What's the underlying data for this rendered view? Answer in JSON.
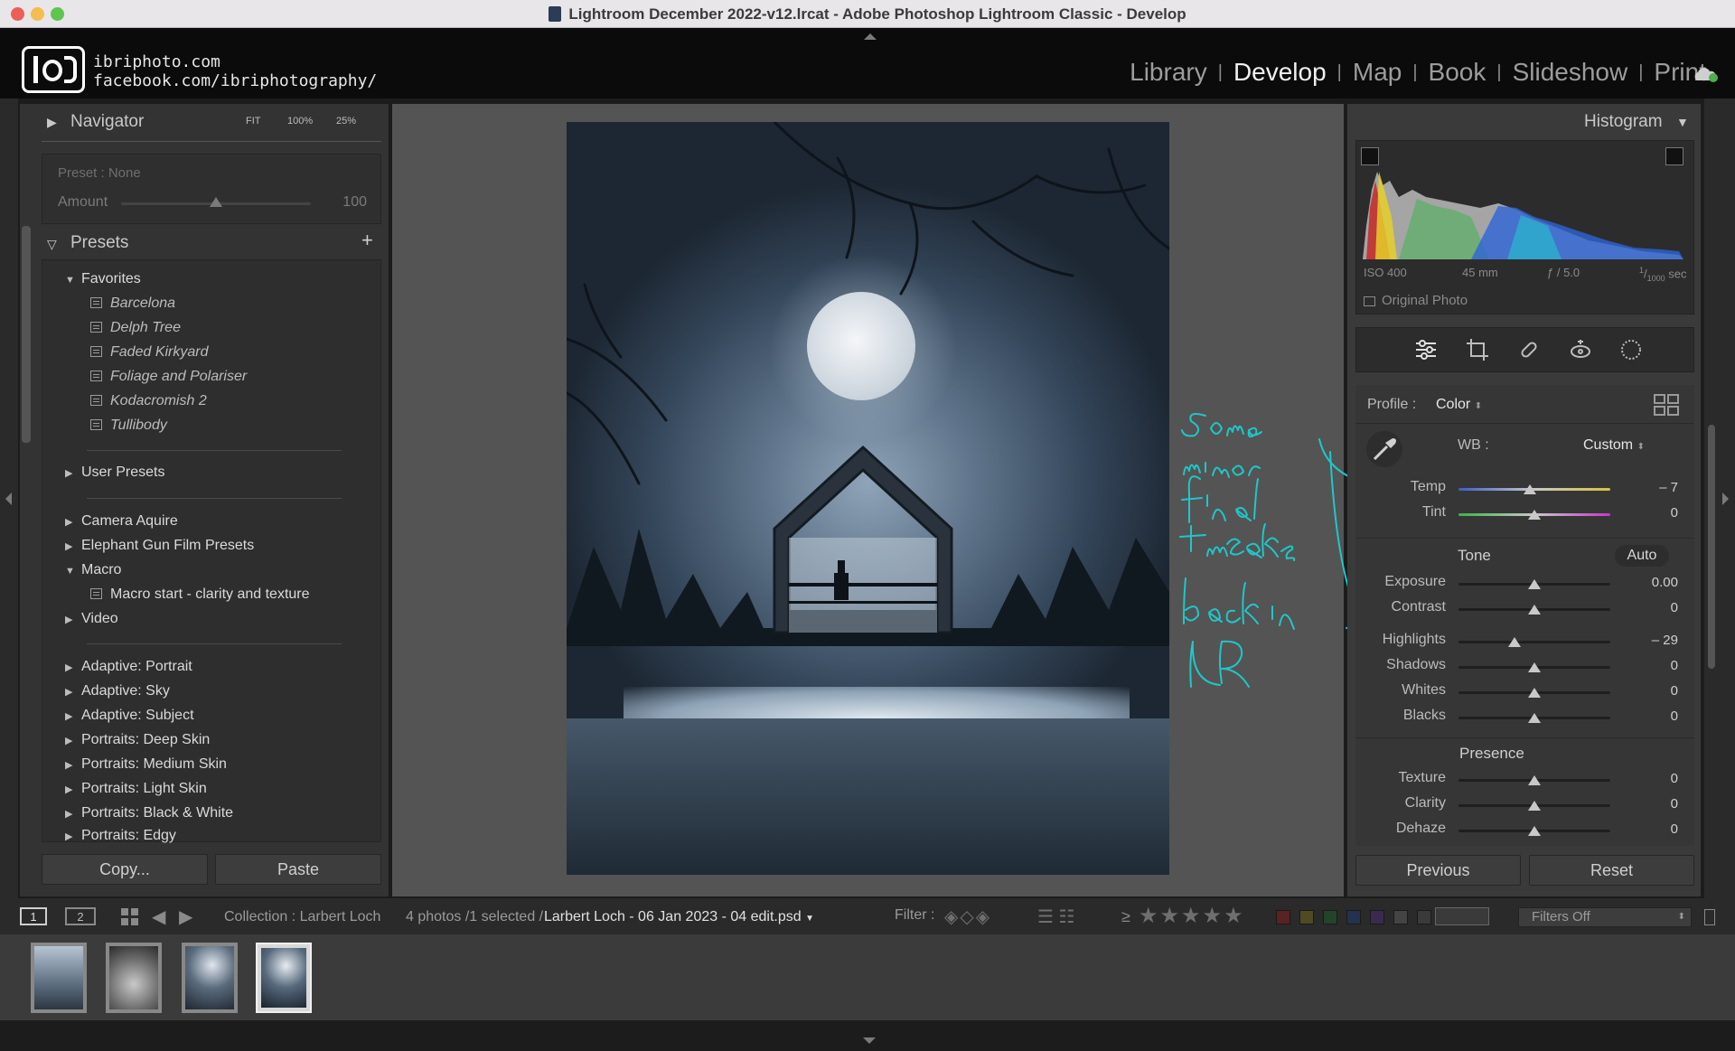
{
  "window": {
    "title": "Lightroom December 2022-v12.lrcat - Adobe Photoshop Lightroom Classic - Develop"
  },
  "identity": {
    "line1": "ibriphoto.com",
    "line2": "facebook.com/ibriphotography/"
  },
  "modules": [
    {
      "label": "Library",
      "active": false
    },
    {
      "label": "Develop",
      "active": true
    },
    {
      "label": "Map",
      "active": false
    },
    {
      "label": "Book",
      "active": false
    },
    {
      "label": "Slideshow",
      "active": false
    },
    {
      "label": "Print",
      "active": false
    }
  ],
  "navigator": {
    "title": "Navigator",
    "fit": "FIT",
    "z100": "100%",
    "z25": "25%"
  },
  "preset_amount": {
    "preset_label": "Preset : None",
    "amount_label": "Amount",
    "amount_value": "100",
    "level": 1.0
  },
  "presets": {
    "title": "Presets",
    "add": "+",
    "favorites": {
      "label": "Favorites",
      "items": [
        "Barcelona",
        "Delph Tree",
        "Faded Kirkyard",
        "Foliage and Polariser",
        "Kodacromish 2",
        "Tullibody"
      ]
    },
    "user_presets": "User Presets",
    "group2": [
      "Camera Aquire",
      "Elephant Gun Film Presets"
    ],
    "macro": {
      "label": "Macro",
      "items": [
        "Macro start - clarity and texture"
      ]
    },
    "video": "Video",
    "group3": [
      "Adaptive: Portrait",
      "Adaptive: Sky",
      "Adaptive: Subject",
      "Portraits: Deep Skin",
      "Portraits: Medium Skin",
      "Portraits: Light Skin",
      "Portraits: Black & White",
      "Portraits: Edgy"
    ]
  },
  "left_buttons": {
    "copy": "Copy...",
    "paste": "Paste"
  },
  "histogram": {
    "title": "Histogram",
    "iso": "ISO 400",
    "focal": "45 mm",
    "aperture": "ƒ / 5.0",
    "shutter_num": "1",
    "shutter_den": "1000",
    "shutter_unit": "sec",
    "original_photo": "Original Photo"
  },
  "basic": {
    "profile_label": "Profile :",
    "profile_value": "Color",
    "wb_label": "WB :",
    "wb_value": "Custom",
    "wb": [
      {
        "label": "Temp",
        "value": "– 7",
        "level": 0.47
      },
      {
        "label": "Tint",
        "value": "0",
        "level": 0.5
      }
    ],
    "tone_title": "Tone",
    "auto": "Auto",
    "tone": [
      {
        "label": "Exposure",
        "value": "0.00",
        "level": 0.5
      },
      {
        "label": "Contrast",
        "value": "0",
        "level": 0.5
      },
      {
        "label": "Highlights",
        "value": "– 29",
        "level": 0.37
      },
      {
        "label": "Shadows",
        "value": "0",
        "level": 0.5
      },
      {
        "label": "Whites",
        "value": "0",
        "level": 0.5
      },
      {
        "label": "Blacks",
        "value": "0",
        "level": 0.5
      }
    ],
    "presence_title": "Presence",
    "presence": [
      {
        "label": "Texture",
        "value": "0",
        "level": 0.5
      },
      {
        "label": "Clarity",
        "value": "0",
        "level": 0.5
      },
      {
        "label": "Dehaze",
        "value": "0",
        "level": 0.5
      }
    ]
  },
  "right_buttons": {
    "previous": "Previous",
    "reset": "Reset"
  },
  "toolbar": {
    "screen1": "1",
    "screen2": "2",
    "collection": "Collection : Larbert Loch",
    "count": "4 photos /1 selected /",
    "filename": "Larbert Loch - 06 Jan 2023 - 04 edit.psd",
    "filter_label": "Filter :",
    "gte": "≥",
    "filters_off": "Filters Off"
  },
  "colors": {
    "accent_cyan": "#1fc7c9",
    "label_red": "#5a2222",
    "label_yellow": "#4f4a22",
    "label_green": "#23442a",
    "label_blue": "#22324f",
    "label_purple": "#3a2a4f"
  }
}
